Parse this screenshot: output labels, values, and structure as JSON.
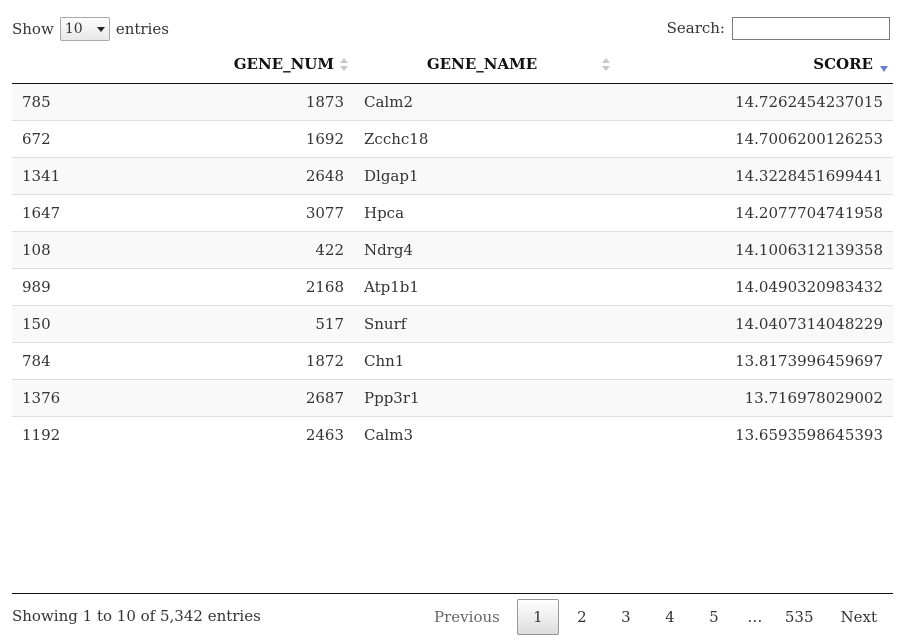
{
  "length_control": {
    "prefix": "Show",
    "selected": "10",
    "suffix": "entries"
  },
  "search": {
    "label": "Search:",
    "value": "",
    "placeholder": ""
  },
  "table": {
    "columns": [
      {
        "label": ""
      },
      {
        "label": "GENE_NUM"
      },
      {
        "label": "GENE_NAME"
      },
      {
        "label": "SCORE"
      }
    ],
    "sorted_column": "SCORE",
    "sort_direction": "descending",
    "rows": [
      [
        "785",
        "1873",
        "Calm2",
        "14.7262454237015"
      ],
      [
        "672",
        "1692",
        "Zcchc18",
        "14.7006200126253"
      ],
      [
        "1341",
        "2648",
        "Dlgap1",
        "14.3228451699441"
      ],
      [
        "1647",
        "3077",
        "Hpca",
        "14.2077704741958"
      ],
      [
        "108",
        "422",
        "Ndrg4",
        "14.1006312139358"
      ],
      [
        "989",
        "2168",
        "Atp1b1",
        "14.0490320983432"
      ],
      [
        "150",
        "517",
        "Snurf",
        "14.0407314048229"
      ],
      [
        "784",
        "1872",
        "Chn1",
        "13.8173996459697"
      ],
      [
        "1376",
        "2687",
        "Ppp3r1",
        "13.716978029002"
      ],
      [
        "1192",
        "2463",
        "Calm3",
        "13.6593598645393"
      ]
    ]
  },
  "info": "Showing 1 to 10 of 5,342 entries",
  "pagination": {
    "previous": "Previous",
    "pages": [
      "1",
      "2",
      "3",
      "4",
      "5"
    ],
    "current": "1",
    "ellipsis": "…",
    "last": "535",
    "next": "Next"
  },
  "colors": {
    "sort_active": "#6e7ec8",
    "sort_inactive": "#c8c8c8",
    "row_stripe": "#f9f9f9",
    "border": "#dddddd"
  }
}
